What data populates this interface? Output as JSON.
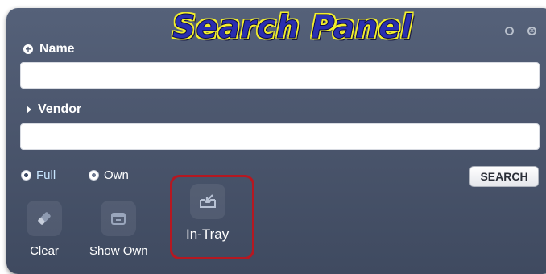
{
  "title_overlay": "Search Panel",
  "window": {
    "minimize_icon": "minus-circle-icon",
    "close_icon": "x-circle-icon"
  },
  "fields": {
    "name": {
      "label": "Name",
      "value": "",
      "placeholder": ""
    },
    "vendor": {
      "label": "Vendor",
      "value": "",
      "placeholder": ""
    }
  },
  "scope": {
    "options": [
      {
        "label": "Full",
        "selected": true
      },
      {
        "label": "Own",
        "selected": false
      }
    ]
  },
  "search_button": {
    "label": "SEARCH"
  },
  "tools": [
    {
      "label": "Clear",
      "icon": "eraser-icon"
    },
    {
      "label": "Show Own",
      "icon": "folder-icon"
    },
    {
      "label": "In-Tray",
      "icon": "inbox-icon"
    }
  ],
  "colors": {
    "panel": "#4b566d",
    "highlight": "#b51821",
    "overlay_fill": "#2a2fb0",
    "overlay_outline": "#f3ef2b"
  }
}
